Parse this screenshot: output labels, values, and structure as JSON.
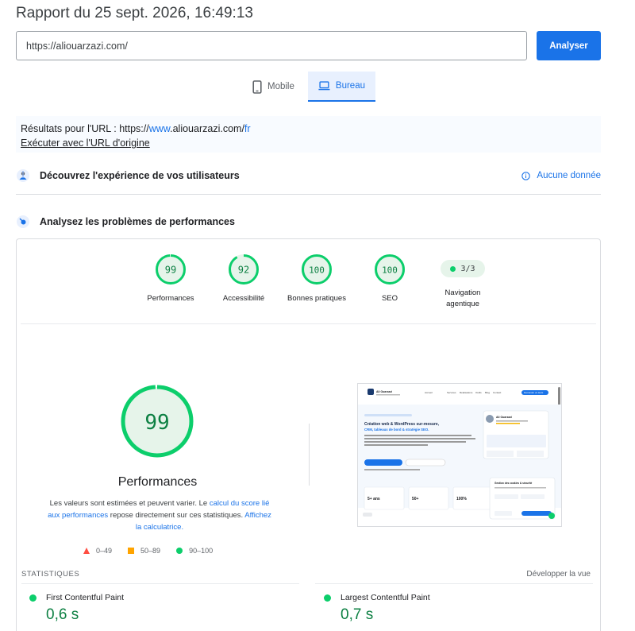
{
  "header": {
    "title": "Rapport du 25 sept. 2026, 16:49:13",
    "url_value": "https://aliouarzazi.com/",
    "analyze_label": "Analyser"
  },
  "device_tabs": {
    "mobile_label": "Mobile",
    "desktop_label": "Bureau",
    "selected": "Bureau"
  },
  "results": {
    "prefix": "Résultats pour l'URL : https://",
    "url_www": "www",
    "url_middle": ".aliouarzazi.com/",
    "url_lang": "fr",
    "rerun_link": "Exécuter avec l'URL d'origine"
  },
  "field_data": {
    "title": "Découvrez l'expérience de vos utilisateurs",
    "status": "Aucune donnée"
  },
  "lab": {
    "title": "Analysez les problèmes de performances",
    "categories": [
      {
        "score": "99",
        "label": "Performances"
      },
      {
        "score": "92",
        "label": "Accessibilité"
      },
      {
        "score": "100",
        "label": "Bonnes pratiques"
      },
      {
        "score": "100",
        "label": "SEO"
      }
    ],
    "agentic": {
      "value": "3/3",
      "label_line1": "Navigation",
      "label_line2": "agentique"
    },
    "main_score": "99",
    "main_label": "Performances",
    "description": {
      "part1": "Les valeurs sont estimées et peuvent varier. Le ",
      "link1": "calcul du score lié aux performances",
      "part2": " repose directement sur ces statistiques. ",
      "link2": "Affichez la calculatrice."
    },
    "legend": {
      "poor": "0–49",
      "average": "50–89",
      "good": "90–100"
    },
    "screenshot": {
      "logo": "Ali Ouarzazi",
      "nav": [
        "Accueil",
        "Services",
        "Réalisations",
        "Outils",
        "Blog",
        "Contact"
      ],
      "cta": "Demander un devis",
      "heading1": "Création web & WordPress sur-mesure,",
      "heading2": "CRM, tableaux de bord & stratégie SEO.",
      "profile_name": "Ali Ouarzazi",
      "stats": [
        "5+ ans",
        "50+",
        "100%"
      ],
      "cookie_title": "Gestion des cookies & sécurité"
    },
    "stats_heading": "STATISTIQUES",
    "expand_label": "Développer la vue",
    "metrics": [
      {
        "name": "First Contentful Paint",
        "value": "0,6 s"
      },
      {
        "name": "Largest Contentful Paint",
        "value": "0,7 s"
      }
    ]
  },
  "colors": {
    "accent": "#1a73e8",
    "good": "#0cce6b",
    "good_text": "#0d8043",
    "good_bg": "#e6f4ea",
    "average": "#ffa400",
    "poor": "#ff4e42"
  },
  "icons": {
    "mobile_tab": "smartphone-icon",
    "desktop_tab": "laptop-icon",
    "field_section": "users-icon",
    "lab_section": "lab-flask-icon",
    "no_data": "info-icon"
  }
}
